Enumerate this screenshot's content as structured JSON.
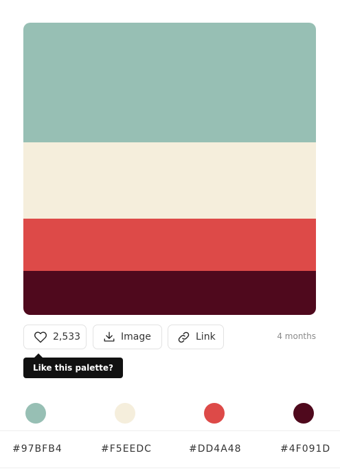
{
  "palette": {
    "colors": [
      {
        "hex_label": "#97BFB4",
        "value": "#97BFB4"
      },
      {
        "hex_label": "#F5EEDC",
        "value": "#F5EEDC"
      },
      {
        "hex_label": "#DD4A48",
        "value": "#DD4A48"
      },
      {
        "hex_label": "#4F091D",
        "value": "#4F091D"
      }
    ]
  },
  "actions": {
    "like_count": "2,533",
    "image_label": "Image",
    "link_label": "Link",
    "time_ago": "4 months",
    "like_tooltip": "Like this palette?"
  },
  "icons": {
    "like": "heart-icon",
    "image": "download-icon",
    "link": "link-icon"
  }
}
